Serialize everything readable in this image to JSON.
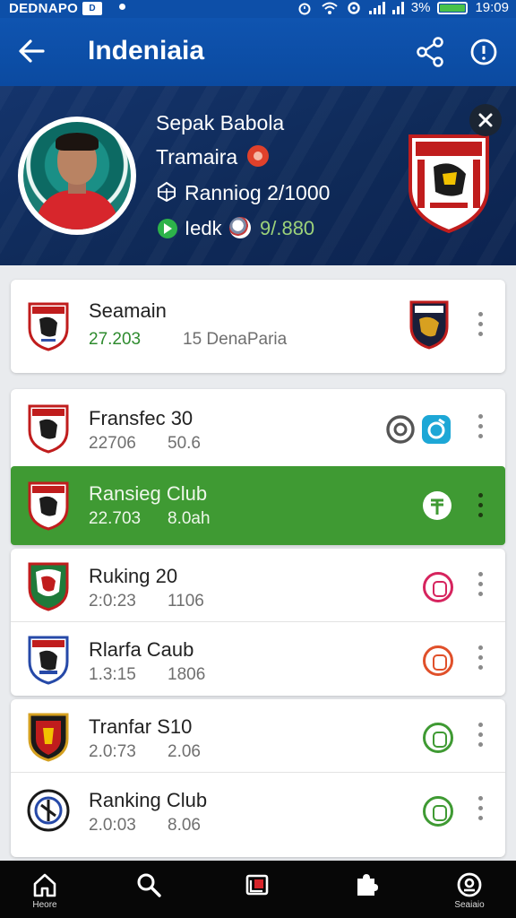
{
  "status_bar": {
    "carrier": "DEDNAPO",
    "badge": "D",
    "battery_percent": "3%",
    "time": "19:09"
  },
  "app_bar": {
    "title": "Indeniaia"
  },
  "profile": {
    "name": "Sepak Babola",
    "role": "Tramaira",
    "ranking": "Ranniog 2/1000",
    "lock_label": "Iedk",
    "score": "9/.880"
  },
  "list": [
    {
      "name": "Seamain",
      "meta": "27.203",
      "meta2": "15   DenaParia",
      "action": "crest",
      "highlighted": false
    },
    {
      "name": "Fransfec 30",
      "meta": "22706",
      "meta2": "50.6",
      "action": "double",
      "highlighted": false
    },
    {
      "name": "Ransieg Club",
      "meta": "22.703",
      "meta2": "8.0ah",
      "action": "currency",
      "highlighted": true
    },
    {
      "name": "Ruking 20",
      "meta": "2:0:23",
      "meta2": "1106",
      "action": "pink",
      "highlighted": false
    },
    {
      "name": "Rlarfa Caub",
      "meta": "1.3:15",
      "meta2": "1806",
      "action": "orange",
      "highlighted": false
    },
    {
      "name": "Tranfar S10",
      "meta": "2.0:73",
      "meta2": "2.06",
      "action": "green",
      "highlighted": false
    },
    {
      "name": "Ranking Club",
      "meta": "2.0:03",
      "meta2": "8.06",
      "action": "green",
      "highlighted": false
    }
  ],
  "bottom_nav": [
    {
      "label": "Heore"
    },
    {
      "label": ""
    },
    {
      "label": ""
    },
    {
      "label": ""
    },
    {
      "label": "Seaiaio"
    }
  ],
  "colors": {
    "primary": "#0d4fa8",
    "header_bg": "#14346c",
    "highlight": "#3f9a33",
    "score": "#9cd27a",
    "meta_green": "#2e8b2e"
  }
}
